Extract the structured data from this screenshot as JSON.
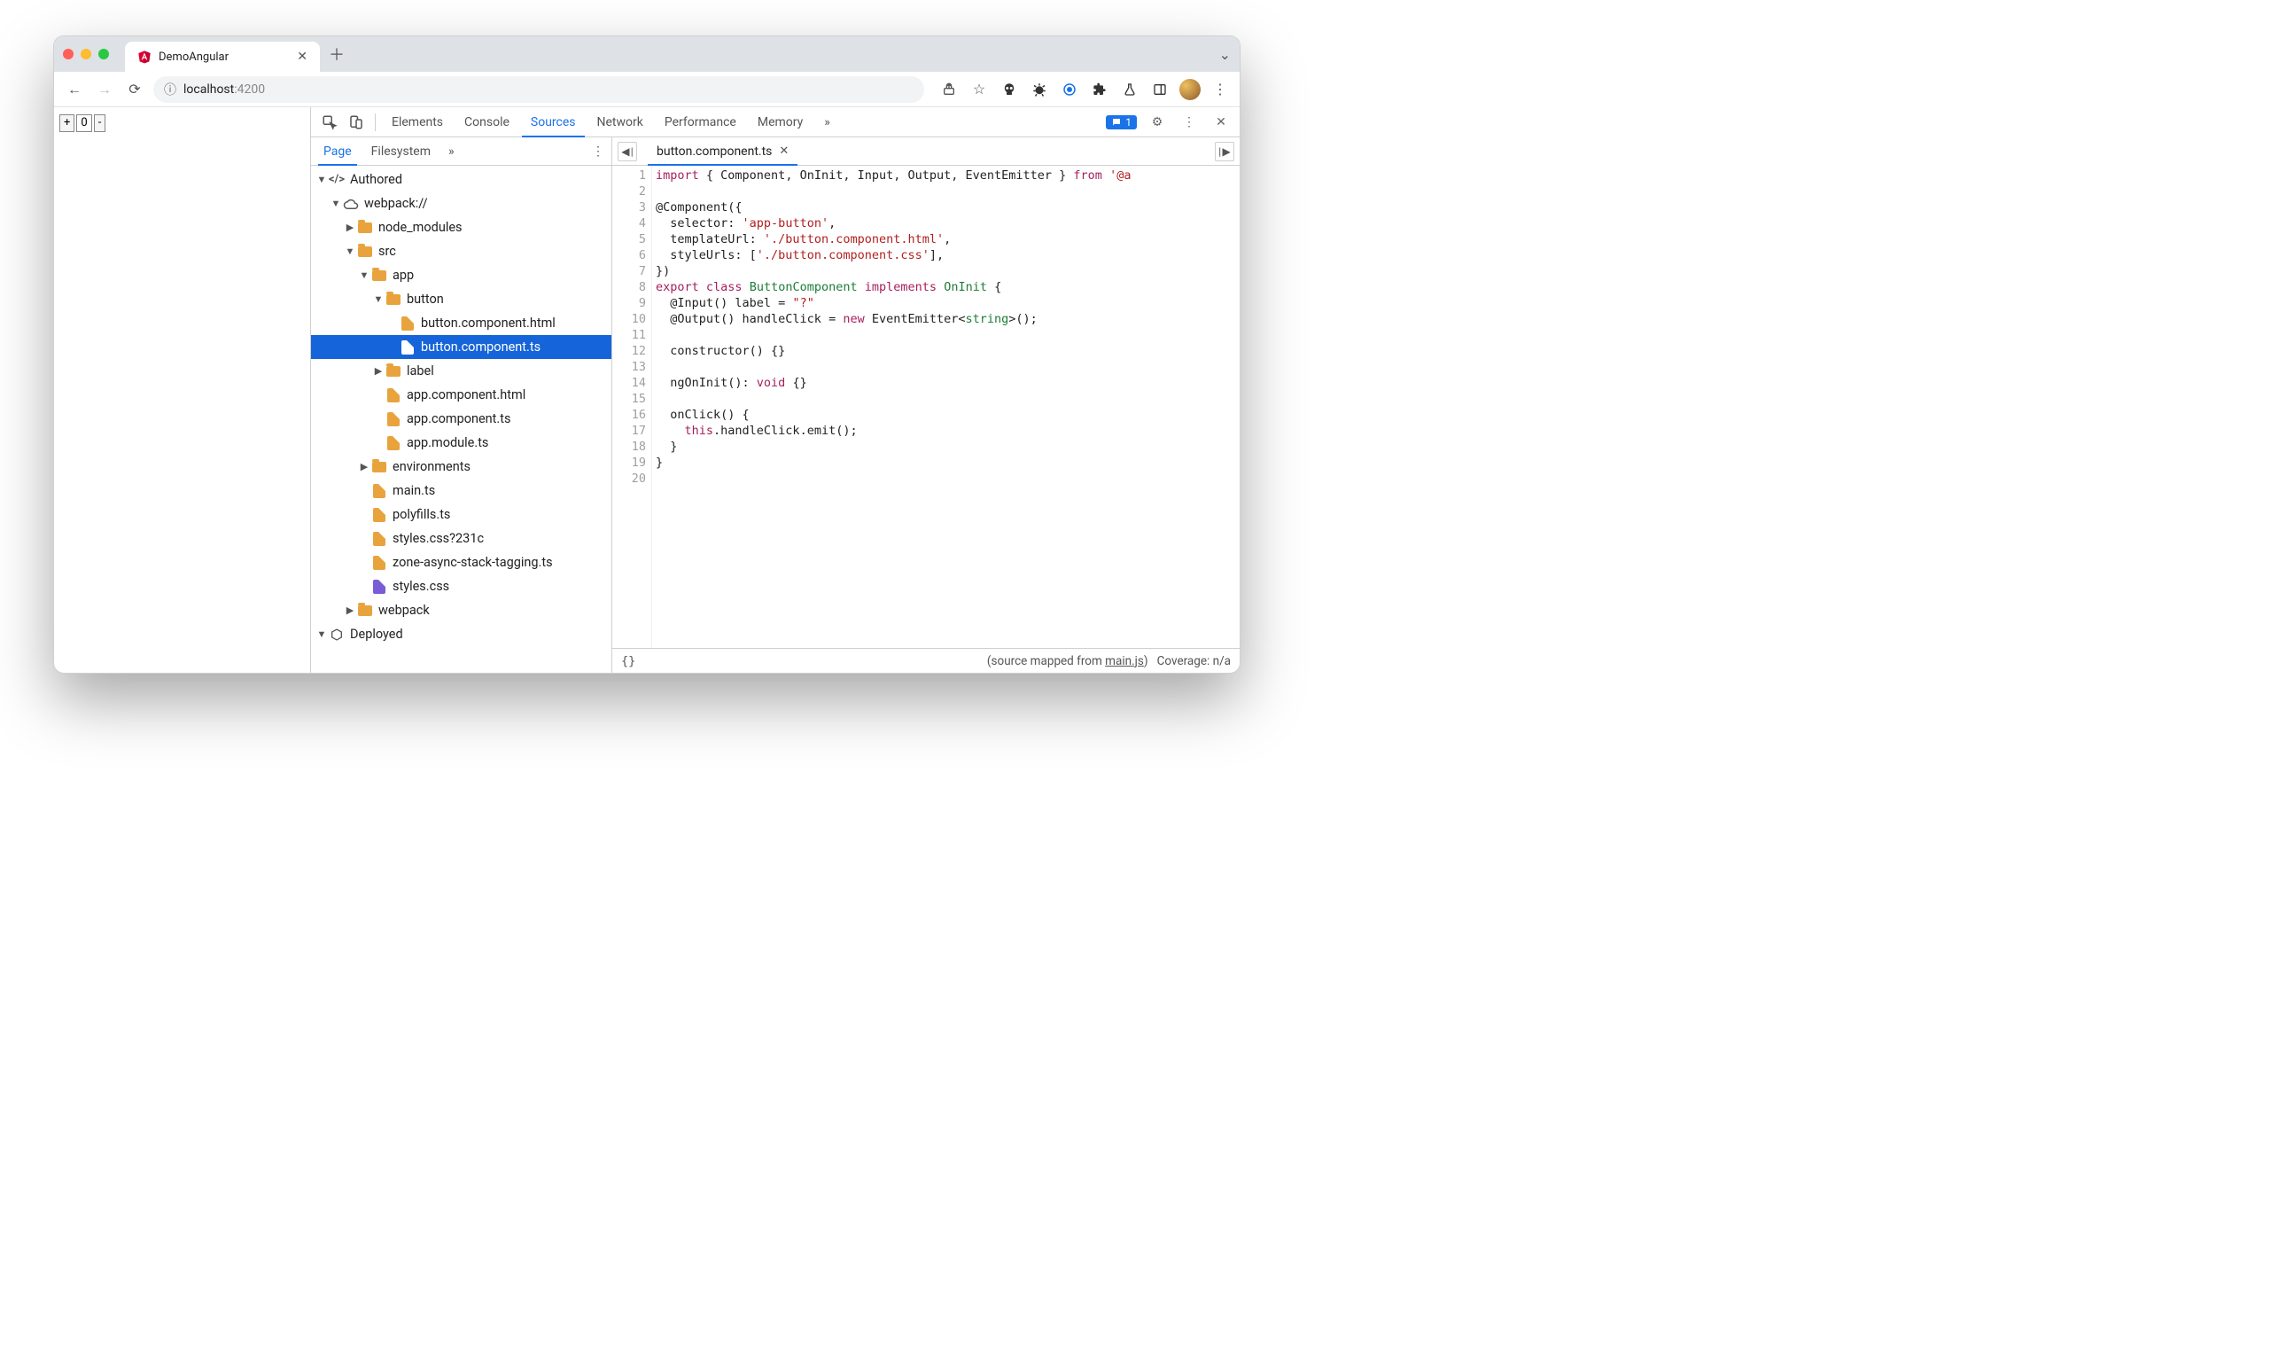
{
  "browser": {
    "tab_title": "DemoAngular",
    "url_host": "localhost",
    "url_port": ":4200"
  },
  "page": {
    "plus": "+",
    "value": "0",
    "minus": "-"
  },
  "devtools": {
    "tabs": [
      "Elements",
      "Console",
      "Sources",
      "Network",
      "Performance",
      "Memory"
    ],
    "active_tab": "Sources",
    "more": "»",
    "issues_count": "1",
    "nav_tabs": [
      "Page",
      "Filesystem"
    ],
    "nav_active": "Page",
    "nav_more": "»",
    "tree": [
      {
        "depth": 0,
        "arrow": "▼",
        "icon": "code",
        "label": "Authored"
      },
      {
        "depth": 1,
        "arrow": "▼",
        "icon": "cloud",
        "label": "webpack://"
      },
      {
        "depth": 2,
        "arrow": "▶",
        "icon": "folder",
        "label": "node_modules"
      },
      {
        "depth": 2,
        "arrow": "▼",
        "icon": "folder",
        "label": "src"
      },
      {
        "depth": 3,
        "arrow": "▼",
        "icon": "folder",
        "label": "app"
      },
      {
        "depth": 4,
        "arrow": "▼",
        "icon": "folder",
        "label": "button"
      },
      {
        "depth": 5,
        "arrow": "",
        "icon": "file",
        "label": "button.component.html"
      },
      {
        "depth": 5,
        "arrow": "",
        "icon": "file",
        "label": "button.component.ts",
        "selected": true
      },
      {
        "depth": 4,
        "arrow": "▶",
        "icon": "folder",
        "label": "label"
      },
      {
        "depth": 4,
        "arrow": "",
        "icon": "file",
        "label": "app.component.html"
      },
      {
        "depth": 4,
        "arrow": "",
        "icon": "file",
        "label": "app.component.ts"
      },
      {
        "depth": 4,
        "arrow": "",
        "icon": "file",
        "label": "app.module.ts"
      },
      {
        "depth": 3,
        "arrow": "▶",
        "icon": "folder",
        "label": "environments"
      },
      {
        "depth": 3,
        "arrow": "",
        "icon": "file",
        "label": "main.ts"
      },
      {
        "depth": 3,
        "arrow": "",
        "icon": "file",
        "label": "polyfills.ts"
      },
      {
        "depth": 3,
        "arrow": "",
        "icon": "file",
        "label": "styles.css?231c"
      },
      {
        "depth": 3,
        "arrow": "",
        "icon": "file",
        "label": "zone-async-stack-tagging.ts"
      },
      {
        "depth": 3,
        "arrow": "",
        "icon": "file-purple",
        "label": "styles.css"
      },
      {
        "depth": 2,
        "arrow": "▶",
        "icon": "folder",
        "label": "webpack"
      },
      {
        "depth": 0,
        "arrow": "▼",
        "icon": "box",
        "label": "Deployed"
      }
    ],
    "editor": {
      "tab": "button.component.ts",
      "lines": [
        [
          [
            "kw",
            "import"
          ],
          [
            "",
            " { Component, OnInit, Input, Output, EventEmitter } "
          ],
          [
            "kw",
            "from"
          ],
          [
            "",
            " "
          ],
          [
            "str",
            "'@a"
          ]
        ],
        [
          [
            "",
            ""
          ]
        ],
        [
          [
            "",
            "@Component({"
          ]
        ],
        [
          [
            "",
            "  selector: "
          ],
          [
            "str",
            "'app-button'"
          ],
          [
            "",
            ","
          ]
        ],
        [
          [
            "",
            "  templateUrl: "
          ],
          [
            "str",
            "'./button.component.html'"
          ],
          [
            "",
            ","
          ]
        ],
        [
          [
            "",
            "  styleUrls: ["
          ],
          [
            "str",
            "'./button.component.css'"
          ],
          [
            "",
            "],"
          ]
        ],
        [
          [
            "",
            "})"
          ]
        ],
        [
          [
            "kw",
            "export"
          ],
          [
            "",
            " "
          ],
          [
            "kw",
            "class"
          ],
          [
            "",
            " "
          ],
          [
            "cls",
            "ButtonComponent"
          ],
          [
            "",
            " "
          ],
          [
            "kw",
            "implements"
          ],
          [
            "",
            " "
          ],
          [
            "cls",
            "OnInit"
          ],
          [
            "",
            " {"
          ]
        ],
        [
          [
            "",
            "  @Input() label = "
          ],
          [
            "str",
            "\"?\""
          ]
        ],
        [
          [
            "",
            "  @Output() handleClick = "
          ],
          [
            "kw",
            "new"
          ],
          [
            "",
            " EventEmitter<"
          ],
          [
            "typ",
            "string"
          ],
          [
            "",
            ">();"
          ]
        ],
        [
          [
            "",
            ""
          ]
        ],
        [
          [
            "",
            "  constructor() {}"
          ]
        ],
        [
          [
            "",
            ""
          ]
        ],
        [
          [
            "",
            "  ngOnInit(): "
          ],
          [
            "kw",
            "void"
          ],
          [
            "",
            " {}"
          ]
        ],
        [
          [
            "",
            ""
          ]
        ],
        [
          [
            "",
            "  onClick() {"
          ]
        ],
        [
          [
            "",
            "    "
          ],
          [
            "kw",
            "this"
          ],
          [
            "",
            ".handleClick.emit();"
          ]
        ],
        [
          [
            "",
            "  }"
          ]
        ],
        [
          [
            "",
            "}"
          ]
        ],
        [
          [
            "",
            ""
          ]
        ]
      ]
    },
    "status": {
      "braces": "{}",
      "mapped_prefix": "(source mapped from ",
      "mapped_link": "main.js",
      "mapped_suffix": ")",
      "coverage": "Coverage: n/a"
    }
  }
}
